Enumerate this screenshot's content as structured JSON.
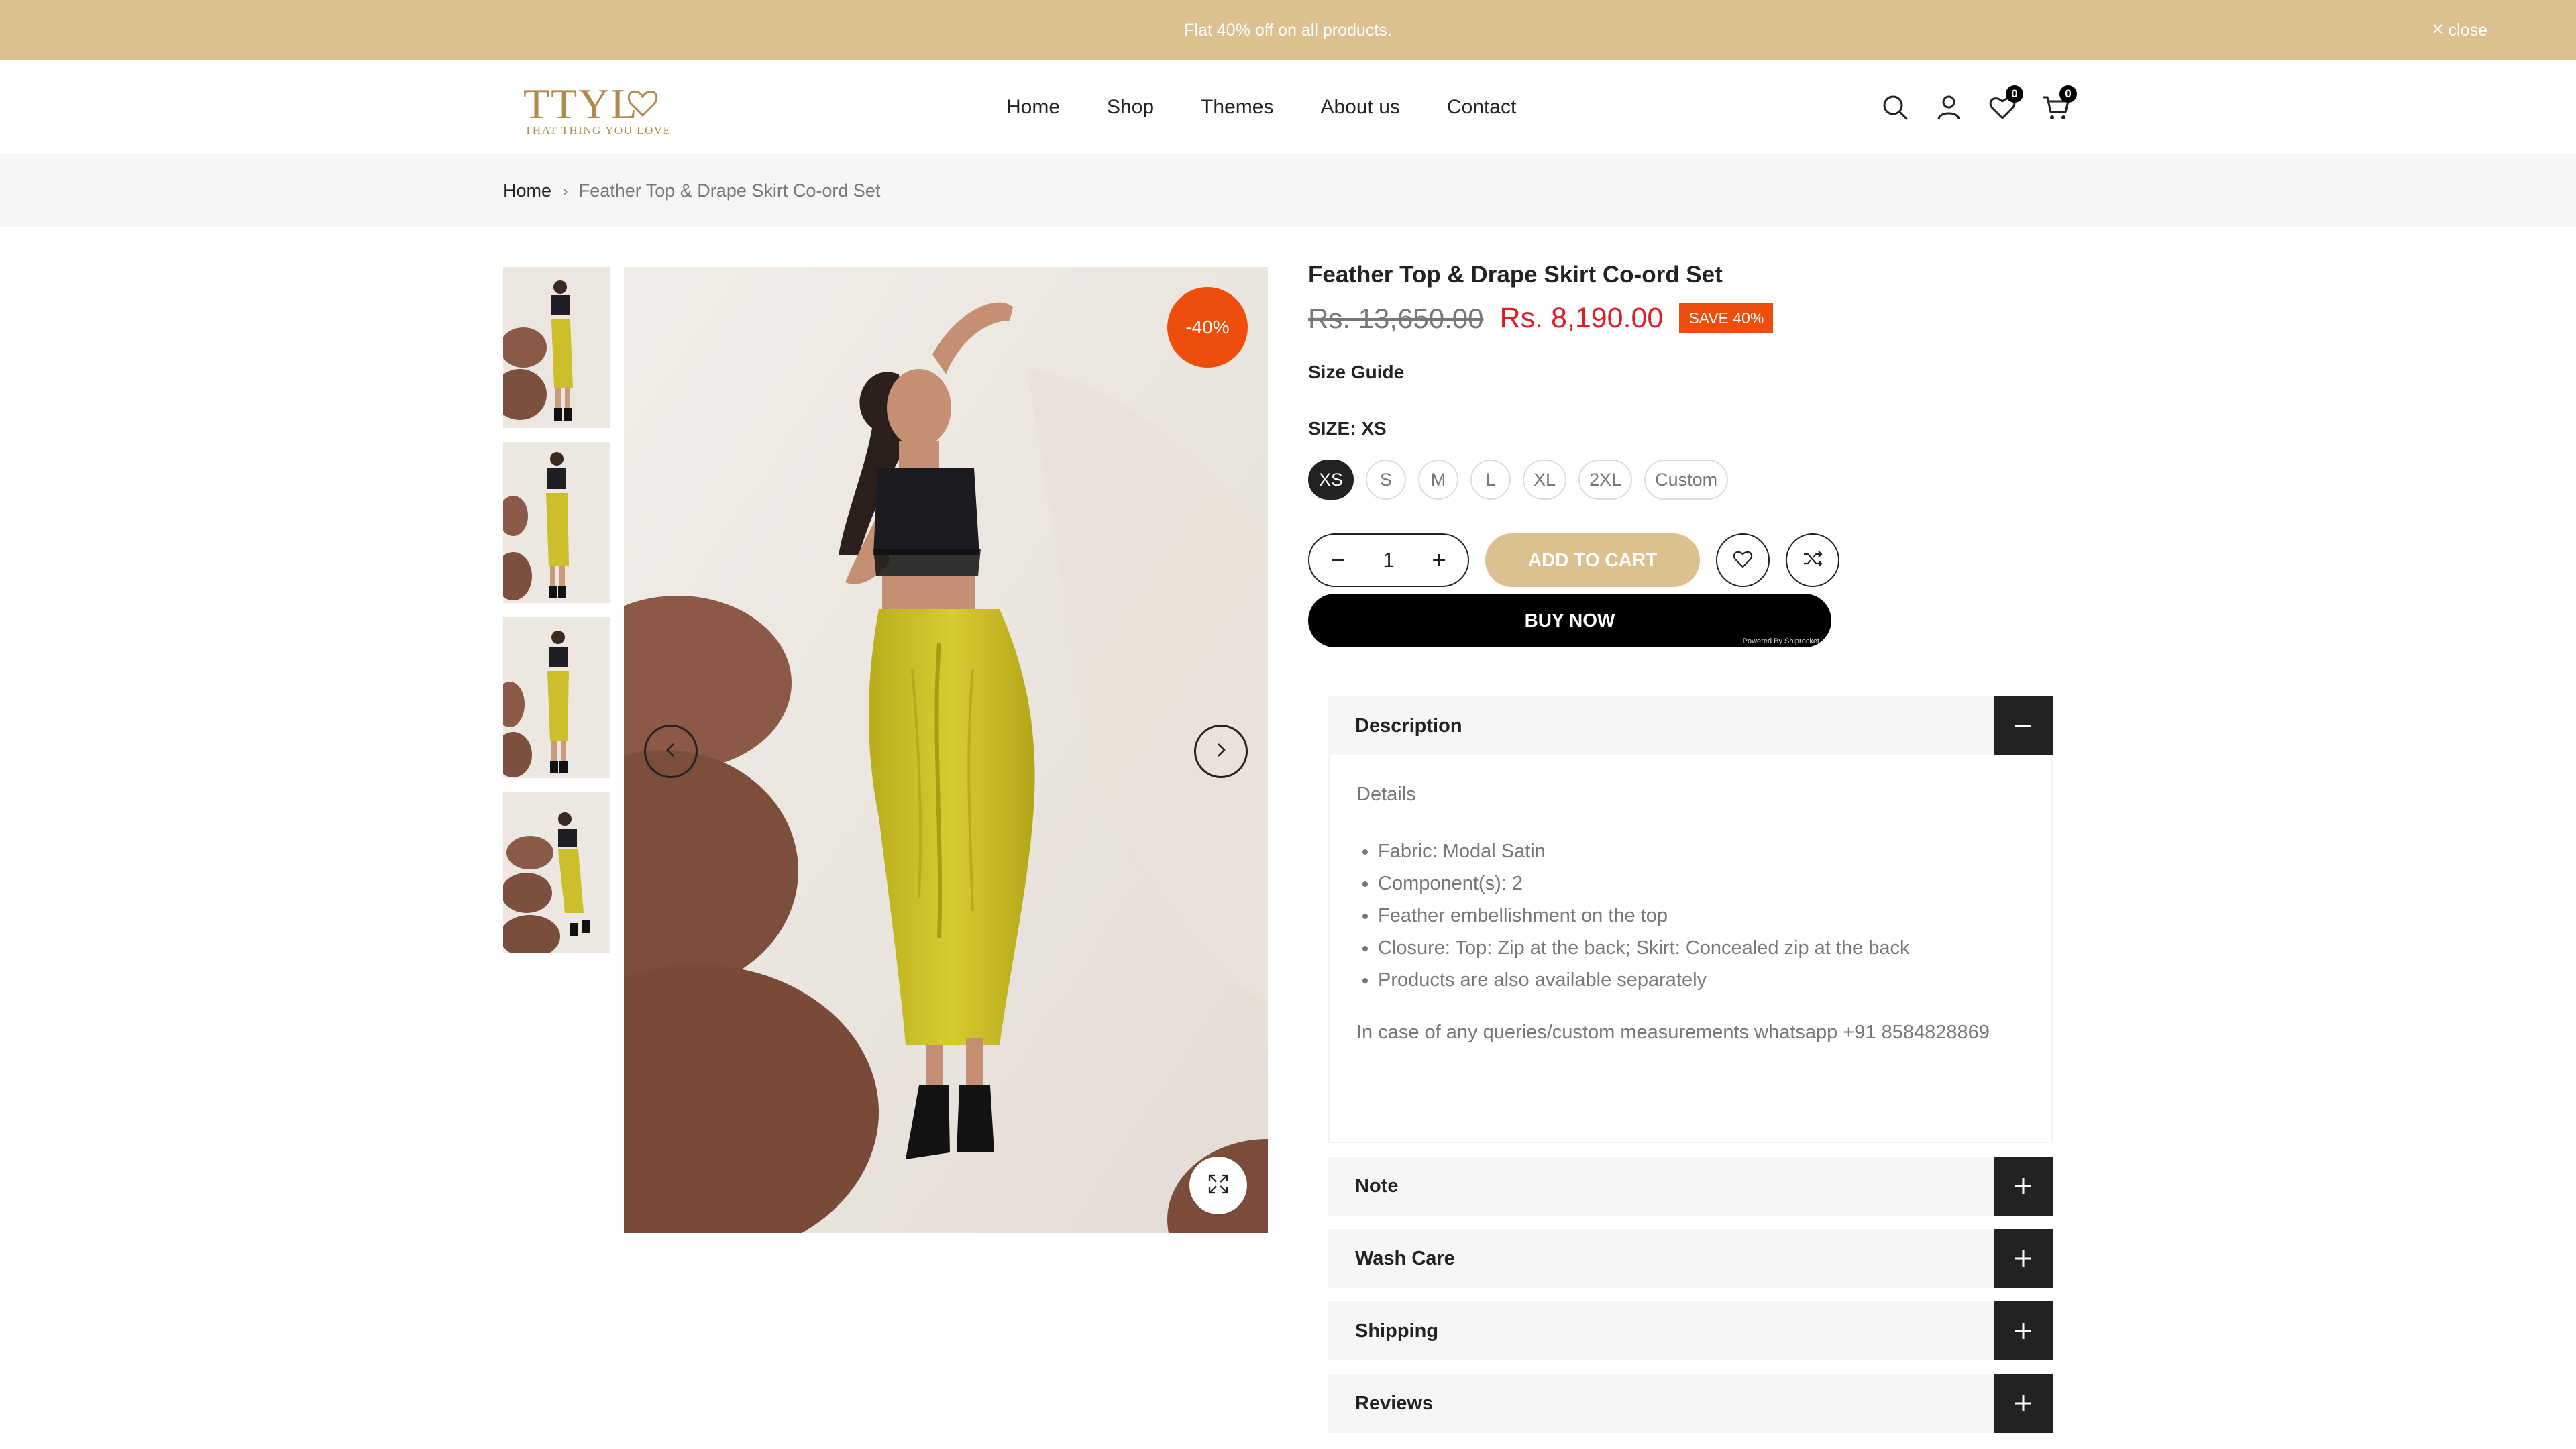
{
  "announcement": {
    "text": "Flat 40% off on all products.",
    "close_label": "close"
  },
  "brand": {
    "logo_text": "TTYL",
    "tagline": "THAT THING YOU LOVE",
    "color": "#b08a4a"
  },
  "nav": {
    "items": [
      "Home",
      "Shop",
      "Themes",
      "About us",
      "Contact"
    ]
  },
  "header_icons": {
    "wishlist_count": "0",
    "cart_count": "0"
  },
  "breadcrumb": {
    "home": "Home",
    "separator": "›",
    "current": "Feather Top & Drape Skirt Co-ord Set"
  },
  "gallery": {
    "thumbnail_count": 4,
    "discount_badge": "-40%"
  },
  "product": {
    "title": "Feather Top & Drape Skirt Co-ord Set",
    "old_price": "Rs. 13,650.00",
    "new_price": "Rs. 8,190.00",
    "save_badge": "SAVE 40%",
    "size_guide": "Size Guide",
    "size_label": "SIZE: XS",
    "sizes": [
      "XS",
      "S",
      "M",
      "L",
      "XL",
      "2XL",
      "Custom"
    ],
    "selected_size": "XS",
    "quantity": "1",
    "add_to_cart": "ADD TO CART",
    "buy_now": "BUY NOW",
    "powered_by": "Powered By Shiprocket"
  },
  "accordions": {
    "description": {
      "title": "Description",
      "heading": "Details",
      "items": [
        "Fabric: Modal Satin",
        "Component(s): 2",
        "Feather embellishment on the top",
        "Closure: Top: Zip at the back; Skirt: Concealed zip at the back",
        "Products are also available separately"
      ],
      "note": "In case of any queries/custom measurements whatsapp +91 8584828869"
    },
    "collapsed": [
      "Note",
      "Wash Care",
      "Shipping",
      "Reviews"
    ]
  },
  "colors": {
    "accent": "#dcc08f",
    "sale": "#ee4d0b",
    "price_red": "#e01e22",
    "dark": "#222222"
  }
}
